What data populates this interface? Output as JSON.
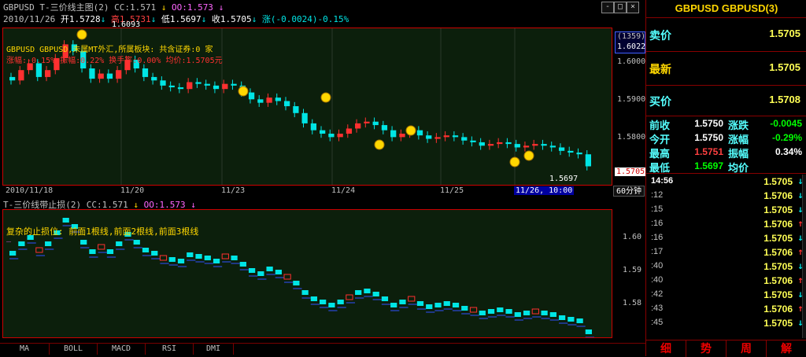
{
  "main_chart": {
    "title_line": "GBPUSD T-三价线主图(2) CC:1.571",
    "title_oo": "OO:1.573",
    "ohlc_date": "2010/11/26",
    "ohlc_open": "开1.5728",
    "ohlc_high": "高1.5731",
    "ohlc_low": "低1.5697",
    "ohlc_close": "收1.5705",
    "ohlc_change": "涨(-0.0024)-0.15%",
    "peak_label": "1.6093",
    "low_label": "1.5697",
    "overlay_line1": "GBPUSD GBPUSD,未属MT外汇,所属板块: 共含证券:0 家",
    "overlay_line2": "涨幅:-0.15% 振幅:0.22% 换手率:0.00% 均价:1.5705元",
    "right_axis": {
      "count_box": "(1359)",
      "top_price": "1.6022",
      "ticks": [
        "1.6000",
        "1.5900",
        "1.5800"
      ],
      "current": "1.5705"
    },
    "x_labels": [
      "2010/11/18",
      "11/20",
      "11/23",
      "11/24",
      "11/25"
    ],
    "x_highlight": "11/26, 10:00",
    "period_label": "60分钟",
    "window_buttons": [
      "-",
      "□",
      "×"
    ]
  },
  "sub_chart": {
    "title_line": "T-三价线带止损(2) CC:1.571",
    "title_oo": "OO:1.573",
    "annotation": "复杂的止损位: 前面1根线,前面2根线,前面3根线",
    "dash": "_",
    "axis_ticks": [
      "1.60",
      "1.59",
      "1.58"
    ]
  },
  "toolbar": [
    "MA",
    "BOLL",
    "MACD",
    "RSI",
    "DMI"
  ],
  "quote_panel": {
    "title": "GBPUSD GBPUSD(3)",
    "sell_label": "卖价",
    "sell_value": "1.5705",
    "latest_label": "最新",
    "latest_value": "1.5705",
    "buy_label": "买价",
    "buy_value": "1.5708",
    "stats": [
      {
        "label": "前收",
        "value": "1.5750",
        "value_color": "#ffffff",
        "label2": "涨跌",
        "value2": "-0.0045",
        "value2_color": "#00ff00"
      },
      {
        "label": "今开",
        "value": "1.5750",
        "value_color": "#ffffff",
        "label2": "涨幅",
        "value2": "-0.29%",
        "value2_color": "#00ff00"
      },
      {
        "label": "最高",
        "value": "1.5751",
        "value_color": "#ff4040",
        "label2": "振幅",
        "value2": "0.34%",
        "value2_color": "#ffffff"
      },
      {
        "label": "最低",
        "value": "1.5697",
        "value_color": "#00ff00",
        "label2": "均价",
        "value2": "",
        "value2_color": "#ffffff"
      }
    ],
    "ticks": [
      {
        "time": "14:56",
        "price": "1.5705",
        "dir": "down"
      },
      {
        "time": ":12",
        "price": "1.5706",
        "dir": "down"
      },
      {
        "time": ":15",
        "price": "1.5705",
        "dir": "down"
      },
      {
        "time": ":16",
        "price": "1.5706",
        "dir": "up"
      },
      {
        "time": ":16",
        "price": "1.5705",
        "dir": "down"
      },
      {
        "time": ":17",
        "price": "1.5706",
        "dir": "up"
      },
      {
        "time": ":40",
        "price": "1.5705",
        "dir": "down"
      },
      {
        "time": ":40",
        "price": "1.5706",
        "dir": "up"
      },
      {
        "time": ":42",
        "price": "1.5705",
        "dir": "down"
      },
      {
        "time": ":43",
        "price": "1.5706",
        "dir": "up"
      },
      {
        "time": ":45",
        "price": "1.5705",
        "dir": "down"
      }
    ],
    "tabs": [
      "细",
      "势",
      "周",
      "解"
    ]
  },
  "colors": {
    "up": "#ff3030",
    "down": "#00e5e5",
    "bg_plot": "#0c1f0c",
    "accent": "#ffd700"
  },
  "chart_data": [
    {
      "type": "candlestick",
      "series_name": "GBPUSD T-三价线主图(2)",
      "ylim": [
        1.5697,
        1.6093
      ],
      "x": [
        "2010/11/18",
        "11/20",
        "11/23",
        "11/24",
        "11/25",
        "11/26"
      ],
      "closes": [
        1.5955,
        1.5985,
        1.6005,
        1.5965,
        1.5985,
        1.602,
        1.606,
        1.604,
        1.599,
        1.596,
        1.5975,
        1.596,
        1.5985,
        1.6015,
        1.599,
        1.5965,
        1.5955,
        1.594,
        1.5935,
        1.593,
        1.595,
        1.5945,
        1.594,
        1.593,
        1.5945,
        1.594,
        1.592,
        1.59,
        1.589,
        1.5905,
        1.5895,
        1.588,
        1.586,
        1.583,
        1.581,
        1.58,
        1.579,
        1.58,
        1.5815,
        1.583,
        1.5835,
        1.5825,
        1.581,
        1.579,
        1.58,
        1.581,
        1.5795,
        1.5785,
        1.579,
        1.5795,
        1.579,
        1.578,
        1.5775,
        1.5765,
        1.577,
        1.5775,
        1.577,
        1.576,
        1.5765,
        1.577,
        1.5765,
        1.576,
        1.575,
        1.5745,
        1.574,
        1.5705
      ]
    },
    {
      "type": "step",
      "series_name": "T-三价线带止损(2)",
      "ylim": [
        1.5705,
        1.606
      ],
      "axis_ticks": [
        1.6,
        1.59,
        1.58
      ]
    }
  ]
}
